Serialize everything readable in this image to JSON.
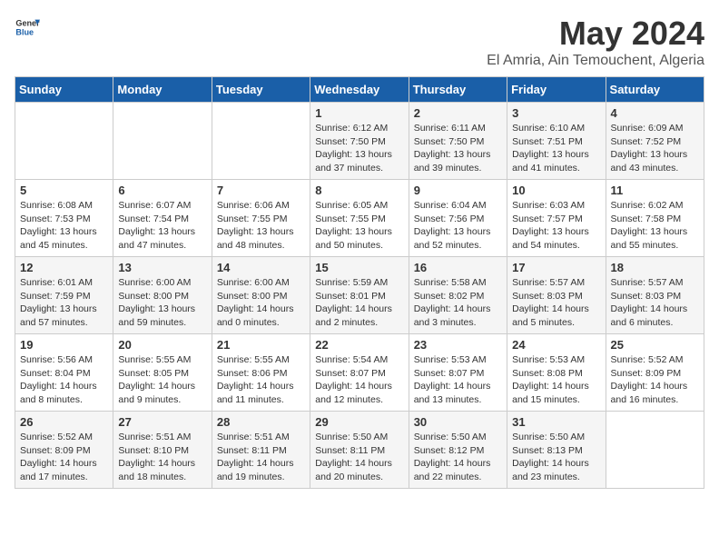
{
  "header": {
    "logo_general": "General",
    "logo_blue": "Blue",
    "title": "May 2024",
    "subtitle": "El Amria, Ain Temouchent, Algeria"
  },
  "weekdays": [
    "Sunday",
    "Monday",
    "Tuesday",
    "Wednesday",
    "Thursday",
    "Friday",
    "Saturday"
  ],
  "weeks": [
    [
      {
        "day": "",
        "info": ""
      },
      {
        "day": "",
        "info": ""
      },
      {
        "day": "",
        "info": ""
      },
      {
        "day": "1",
        "info": "Sunrise: 6:12 AM\nSunset: 7:50 PM\nDaylight: 13 hours and 37 minutes."
      },
      {
        "day": "2",
        "info": "Sunrise: 6:11 AM\nSunset: 7:50 PM\nDaylight: 13 hours and 39 minutes."
      },
      {
        "day": "3",
        "info": "Sunrise: 6:10 AM\nSunset: 7:51 PM\nDaylight: 13 hours and 41 minutes."
      },
      {
        "day": "4",
        "info": "Sunrise: 6:09 AM\nSunset: 7:52 PM\nDaylight: 13 hours and 43 minutes."
      }
    ],
    [
      {
        "day": "5",
        "info": "Sunrise: 6:08 AM\nSunset: 7:53 PM\nDaylight: 13 hours and 45 minutes."
      },
      {
        "day": "6",
        "info": "Sunrise: 6:07 AM\nSunset: 7:54 PM\nDaylight: 13 hours and 47 minutes."
      },
      {
        "day": "7",
        "info": "Sunrise: 6:06 AM\nSunset: 7:55 PM\nDaylight: 13 hours and 48 minutes."
      },
      {
        "day": "8",
        "info": "Sunrise: 6:05 AM\nSunset: 7:55 PM\nDaylight: 13 hours and 50 minutes."
      },
      {
        "day": "9",
        "info": "Sunrise: 6:04 AM\nSunset: 7:56 PM\nDaylight: 13 hours and 52 minutes."
      },
      {
        "day": "10",
        "info": "Sunrise: 6:03 AM\nSunset: 7:57 PM\nDaylight: 13 hours and 54 minutes."
      },
      {
        "day": "11",
        "info": "Sunrise: 6:02 AM\nSunset: 7:58 PM\nDaylight: 13 hours and 55 minutes."
      }
    ],
    [
      {
        "day": "12",
        "info": "Sunrise: 6:01 AM\nSunset: 7:59 PM\nDaylight: 13 hours and 57 minutes."
      },
      {
        "day": "13",
        "info": "Sunrise: 6:00 AM\nSunset: 8:00 PM\nDaylight: 13 hours and 59 minutes."
      },
      {
        "day": "14",
        "info": "Sunrise: 6:00 AM\nSunset: 8:00 PM\nDaylight: 14 hours and 0 minutes."
      },
      {
        "day": "15",
        "info": "Sunrise: 5:59 AM\nSunset: 8:01 PM\nDaylight: 14 hours and 2 minutes."
      },
      {
        "day": "16",
        "info": "Sunrise: 5:58 AM\nSunset: 8:02 PM\nDaylight: 14 hours and 3 minutes."
      },
      {
        "day": "17",
        "info": "Sunrise: 5:57 AM\nSunset: 8:03 PM\nDaylight: 14 hours and 5 minutes."
      },
      {
        "day": "18",
        "info": "Sunrise: 5:57 AM\nSunset: 8:03 PM\nDaylight: 14 hours and 6 minutes."
      }
    ],
    [
      {
        "day": "19",
        "info": "Sunrise: 5:56 AM\nSunset: 8:04 PM\nDaylight: 14 hours and 8 minutes."
      },
      {
        "day": "20",
        "info": "Sunrise: 5:55 AM\nSunset: 8:05 PM\nDaylight: 14 hours and 9 minutes."
      },
      {
        "day": "21",
        "info": "Sunrise: 5:55 AM\nSunset: 8:06 PM\nDaylight: 14 hours and 11 minutes."
      },
      {
        "day": "22",
        "info": "Sunrise: 5:54 AM\nSunset: 8:07 PM\nDaylight: 14 hours and 12 minutes."
      },
      {
        "day": "23",
        "info": "Sunrise: 5:53 AM\nSunset: 8:07 PM\nDaylight: 14 hours and 13 minutes."
      },
      {
        "day": "24",
        "info": "Sunrise: 5:53 AM\nSunset: 8:08 PM\nDaylight: 14 hours and 15 minutes."
      },
      {
        "day": "25",
        "info": "Sunrise: 5:52 AM\nSunset: 8:09 PM\nDaylight: 14 hours and 16 minutes."
      }
    ],
    [
      {
        "day": "26",
        "info": "Sunrise: 5:52 AM\nSunset: 8:09 PM\nDaylight: 14 hours and 17 minutes."
      },
      {
        "day": "27",
        "info": "Sunrise: 5:51 AM\nSunset: 8:10 PM\nDaylight: 14 hours and 18 minutes."
      },
      {
        "day": "28",
        "info": "Sunrise: 5:51 AM\nSunset: 8:11 PM\nDaylight: 14 hours and 19 minutes."
      },
      {
        "day": "29",
        "info": "Sunrise: 5:50 AM\nSunset: 8:11 PM\nDaylight: 14 hours and 20 minutes."
      },
      {
        "day": "30",
        "info": "Sunrise: 5:50 AM\nSunset: 8:12 PM\nDaylight: 14 hours and 22 minutes."
      },
      {
        "day": "31",
        "info": "Sunrise: 5:50 AM\nSunset: 8:13 PM\nDaylight: 14 hours and 23 minutes."
      },
      {
        "day": "",
        "info": ""
      }
    ]
  ]
}
